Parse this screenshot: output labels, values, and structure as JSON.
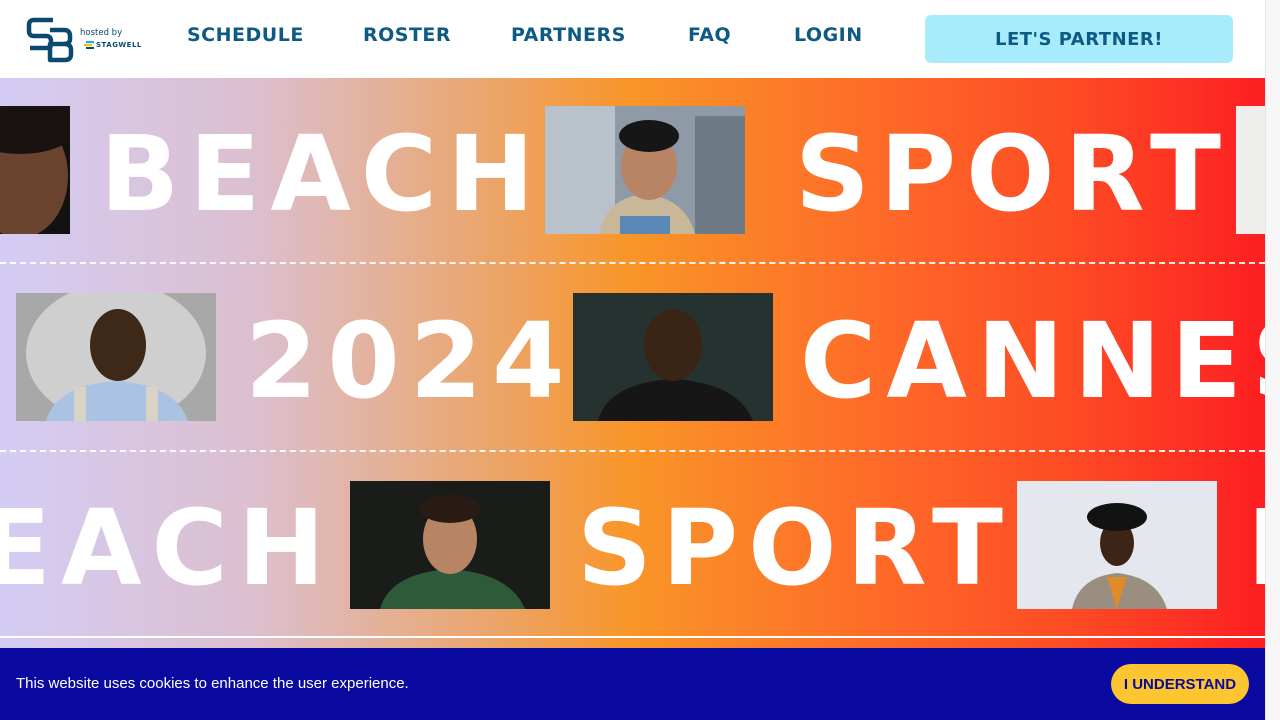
{
  "header": {
    "hosted_by": "hosted by",
    "host_brand": "STAGWELL",
    "nav": [
      {
        "label": "SCHEDULE"
      },
      {
        "label": "ROSTER"
      },
      {
        "label": "PARTNERS"
      },
      {
        "label": "FAQ"
      },
      {
        "label": "LOGIN"
      }
    ],
    "cta_label": "LET'S PARTNER!"
  },
  "hero": {
    "row1": [
      "BEACH",
      "SPORT"
    ],
    "row2": [
      "2024",
      "CANNES"
    ],
    "row3": [
      "EACH",
      "SPORT"
    ]
  },
  "cookie": {
    "message": "This website uses cookies to enhance the user experience.",
    "button_label": "I UNDERSTAND"
  },
  "colors": {
    "nav_text": "#0d5a85",
    "cta_bg": "#a8ecfb",
    "cookie_bg": "#0a0aa0",
    "cookie_button": "#fdc52f",
    "gradient_start": "#d4ccf4",
    "gradient_mid": "#f99528",
    "gradient_end": "#fd1f22"
  },
  "icons": {
    "logo": "sb-monogram-logo",
    "host_logo": "stagwell-logo"
  }
}
